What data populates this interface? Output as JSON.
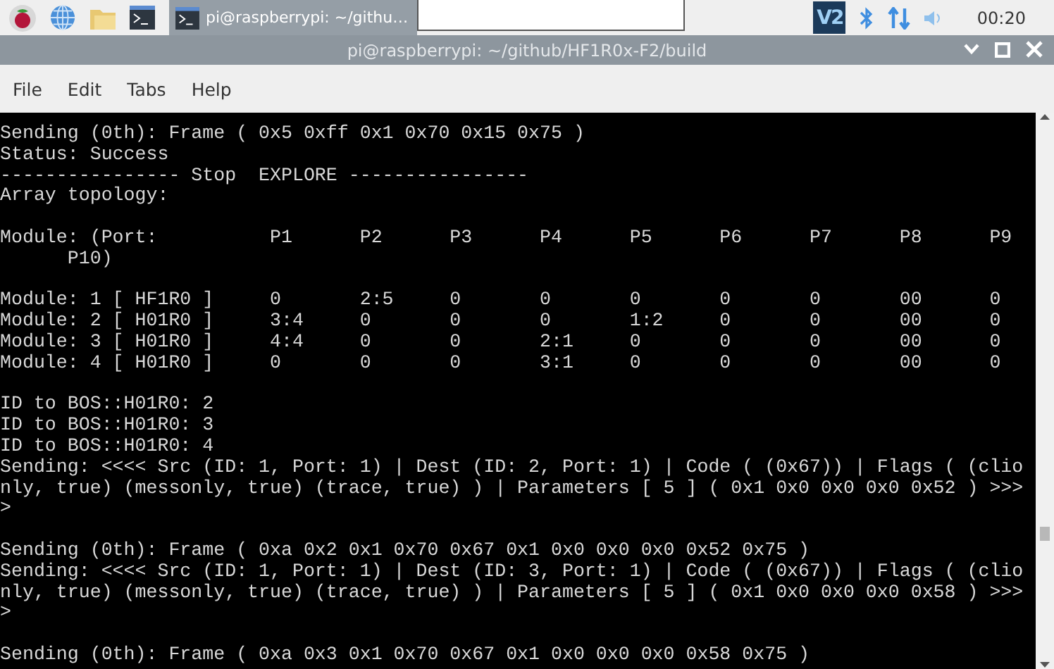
{
  "taskbar": {
    "task_title": "pi@raspberrypi: ~/githu…",
    "tray_label": "V2",
    "clock": "00:20"
  },
  "window": {
    "title": "pi@raspberrypi: ~/github/HF1R0x-F2/build"
  },
  "menu": [
    "File",
    "Edit",
    "Tabs",
    "Help"
  ],
  "terminal": {
    "blocks": [
      [
        "Sending (0th): Frame ( 0x5 0xff 0x1 0x70 0x15 0x75 )",
        "Status: Success",
        "---------------- Stop  EXPLORE ----------------",
        "Array topology:"
      ],
      [
        "Module: (Port:          P1      P2      P3      P4      P5      P6      P7      P8      P9",
        "      P10)"
      ],
      [
        "Module: 1 [ HF1R0 ]     0       2:5     0       0       0       0       0       00      0",
        "Module: 2 [ H01R0 ]     3:4     0       0       0       1:2     0       0       00      0",
        "Module: 3 [ H01R0 ]     4:4     0       0       2:1     0       0       0       00      0",
        "Module: 4 [ H01R0 ]     0       0       0       3:1     0       0       0       00      0"
      ],
      [
        "ID to BOS::H01R0: 2",
        "ID to BOS::H01R0: 3",
        "ID to BOS::H01R0: 4",
        "Sending: <<<< Src (ID: 1, Port: 1) | Dest (ID: 2, Port: 1) | Code ( (0x67)) | Flags ( (clio",
        "nly, true) (messonly, true) (trace, true) ) | Parameters [ 5 ] ( 0x1 0x0 0x0 0x0 0x52 ) >>>",
        ">"
      ],
      [
        "Sending (0th): Frame ( 0xa 0x2 0x1 0x70 0x67 0x1 0x0 0x0 0x0 0x52 0x75 )",
        "Sending: <<<< Src (ID: 1, Port: 1) | Dest (ID: 3, Port: 1) | Code ( (0x67)) | Flags ( (clio",
        "nly, true) (messonly, true) (trace, true) ) | Parameters [ 5 ] ( 0x1 0x0 0x0 0x0 0x58 ) >>>",
        ">"
      ],
      [
        "Sending (0th): Frame ( 0xa 0x3 0x1 0x70 0x67 0x1 0x0 0x0 0x0 0x58 0x75 )"
      ]
    ]
  }
}
